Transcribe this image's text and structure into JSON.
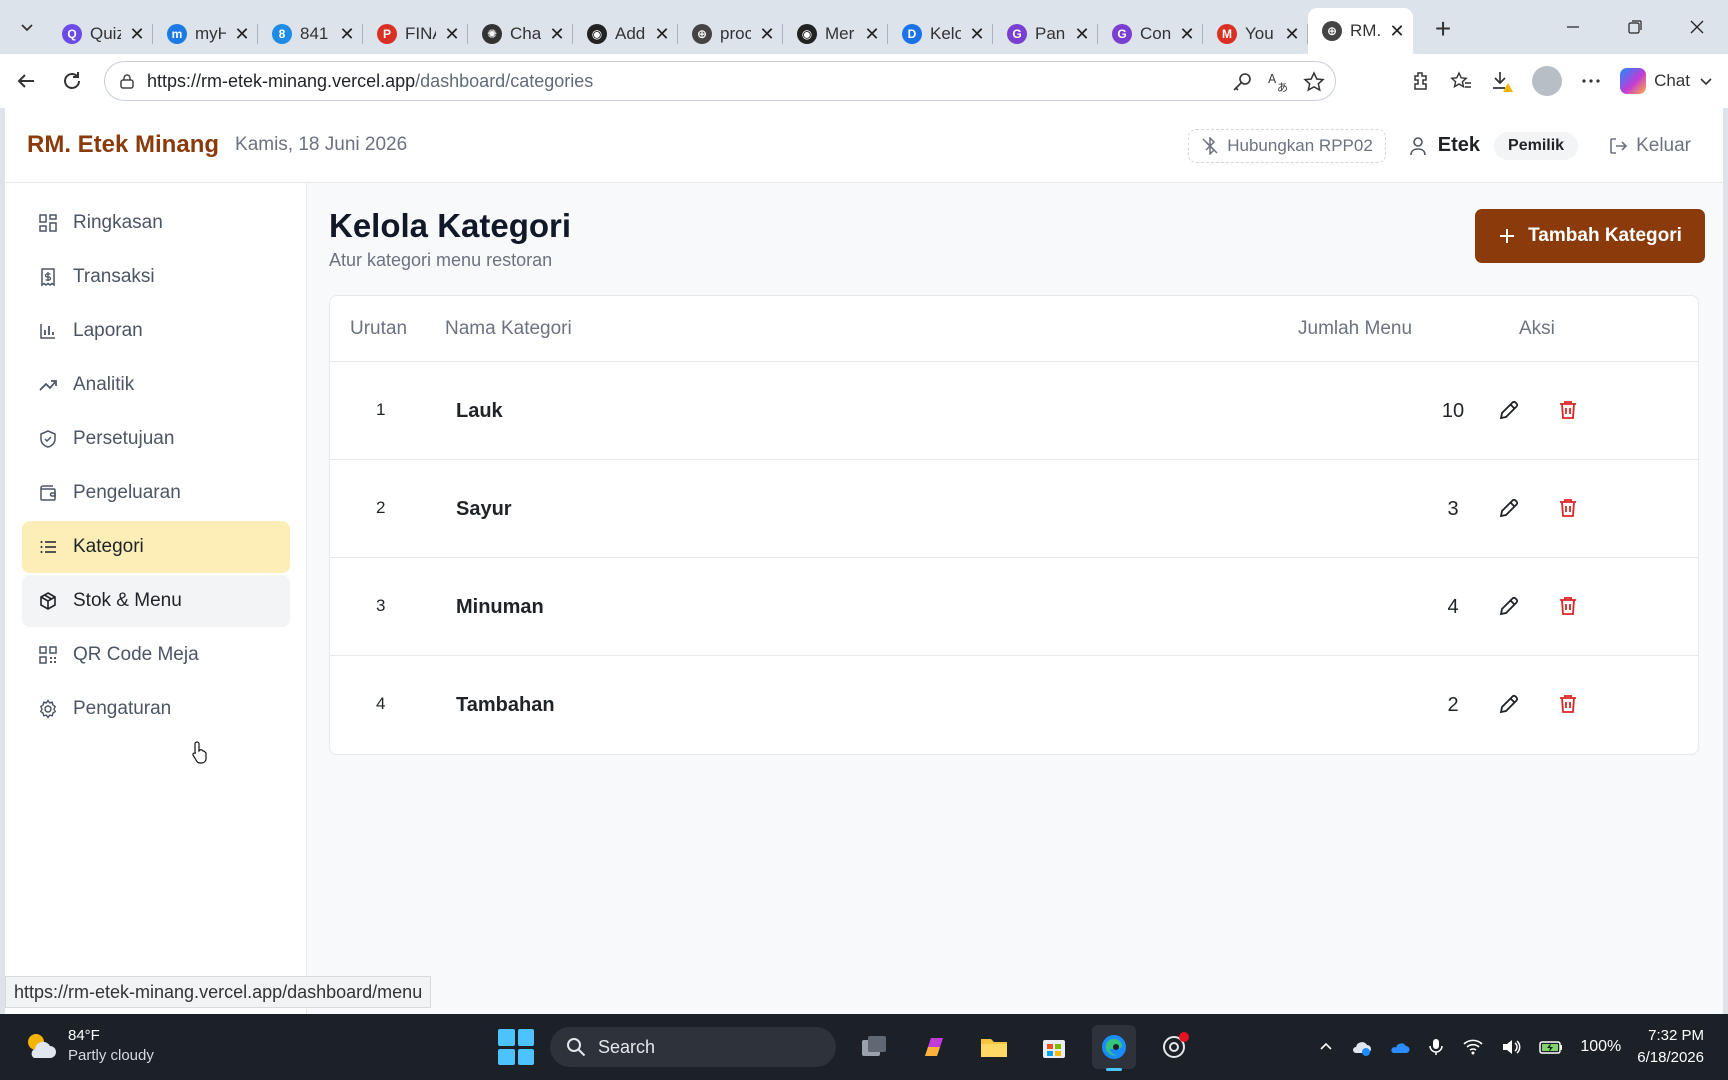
{
  "browser": {
    "tabs": [
      {
        "title": "Quiz",
        "icon": "quiz-icon",
        "color": "#6b4ce6"
      },
      {
        "title": "myH",
        "icon": "myh-icon",
        "color": "#1b7ae6"
      },
      {
        "title": "841",
        "icon": "app-icon",
        "color": "#1e8be6"
      },
      {
        "title": "FINA",
        "icon": "pdf-icon",
        "color": "#d93025"
      },
      {
        "title": "Chat",
        "icon": "chatgpt-icon",
        "color": "#333333"
      },
      {
        "title": "Add",
        "icon": "github-icon",
        "color": "#222222"
      },
      {
        "title": "proc",
        "icon": "globe-icon",
        "color": "#444444"
      },
      {
        "title": "Mer",
        "icon": "github-icon",
        "color": "#222222"
      },
      {
        "title": "Kelo",
        "icon": "docs-icon",
        "color": "#1a73e8"
      },
      {
        "title": "Pan",
        "icon": "g-icon",
        "color": "#7a3fd0"
      },
      {
        "title": "Con",
        "icon": "g-icon",
        "color": "#7a3fd0"
      },
      {
        "title": "You",
        "icon": "gmail-icon",
        "color": "#d93025"
      },
      {
        "title": "RM.",
        "icon": "globe-icon",
        "color": "#444444",
        "active": true
      }
    ],
    "url_base": "https://rm-etek-minang.vercel.app",
    "url_path": "/dashboard/categories",
    "chat_label": "Chat"
  },
  "app": {
    "brand": "RM. Etek Minang",
    "date": "Kamis, 18 Juni 2026",
    "printer": "Hubungkan RPP02",
    "user_name": "Etek",
    "user_role": "Pemilik",
    "logout": "Keluar",
    "accent": "#8b3a0b"
  },
  "sidebar": {
    "items": [
      {
        "label": "Ringkasan",
        "icon": "grid-icon",
        "state": ""
      },
      {
        "label": "Transaksi",
        "icon": "receipt-icon",
        "state": ""
      },
      {
        "label": "Laporan",
        "icon": "bar-chart-icon",
        "state": ""
      },
      {
        "label": "Analitik",
        "icon": "trend-icon",
        "state": ""
      },
      {
        "label": "Persetujuan",
        "icon": "shield-check-icon",
        "state": ""
      },
      {
        "label": "Pengeluaran",
        "icon": "wallet-icon",
        "state": ""
      },
      {
        "label": "Kategori",
        "icon": "list-icon",
        "state": "active"
      },
      {
        "label": "Stok & Menu",
        "icon": "package-icon",
        "state": "hover"
      },
      {
        "label": "QR Code Meja",
        "icon": "qr-icon",
        "state": ""
      },
      {
        "label": "Pengaturan",
        "icon": "gear-icon",
        "state": ""
      }
    ]
  },
  "page": {
    "title": "Kelola Kategori",
    "subtitle": "Atur kategori menu restoran",
    "add_button": "Tambah Kategori"
  },
  "table": {
    "headers": {
      "order": "Urutan",
      "name": "Nama Kategori",
      "count": "Jumlah Menu",
      "actions": "Aksi"
    },
    "rows": [
      {
        "order": "1",
        "name": "Lauk",
        "count": "10"
      },
      {
        "order": "2",
        "name": "Sayur",
        "count": "3"
      },
      {
        "order": "3",
        "name": "Minuman",
        "count": "4"
      },
      {
        "order": "4",
        "name": "Tambahan",
        "count": "2"
      }
    ]
  },
  "status_url": "https://rm-etek-minang.vercel.app/dashboard/menu",
  "taskbar": {
    "temperature": "84°F",
    "condition": "Partly cloudy",
    "search": "Search",
    "battery": "100%",
    "time": "7:32 PM",
    "date": "6/18/2026"
  }
}
